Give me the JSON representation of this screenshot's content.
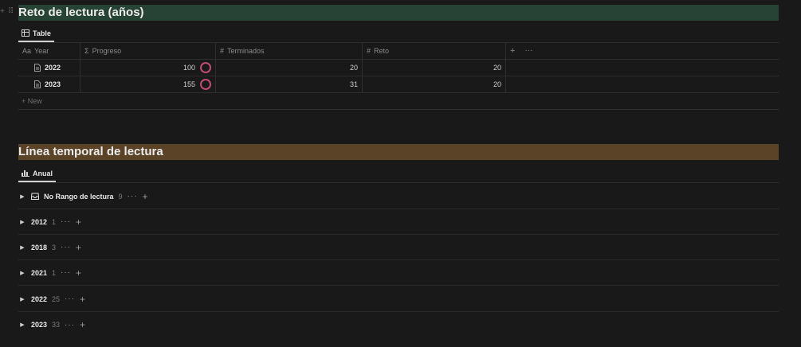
{
  "section1": {
    "title": "Reto de lectura (años)",
    "banner_color": "#264336",
    "tab_label": "Table",
    "columns": [
      {
        "prefix": "Aa",
        "label": "Year"
      },
      {
        "prefix": "Σ",
        "label": "Progreso"
      },
      {
        "prefix": "#",
        "label": "Terminados"
      },
      {
        "prefix": "#",
        "label": "Reto"
      }
    ],
    "rows": [
      {
        "year": "2022",
        "progreso": "100",
        "terminados": "20",
        "reto": "20"
      },
      {
        "year": "2023",
        "progreso": "155",
        "terminados": "31",
        "reto": "20"
      }
    ],
    "new_label": "New",
    "progress_ring_color": "#c24a77"
  },
  "section2": {
    "title": "Línea temporal de lectura",
    "banner_color": "#5b4328",
    "tab_label": "Anual",
    "groups": [
      {
        "name": "No Rango de lectura",
        "count": "9",
        "icon": "inbox-icon"
      },
      {
        "name": "2012",
        "count": "1"
      },
      {
        "name": "2018",
        "count": "3"
      },
      {
        "name": "2021",
        "count": "1"
      },
      {
        "name": "2022",
        "count": "25"
      },
      {
        "name": "2023",
        "count": "33"
      }
    ]
  }
}
